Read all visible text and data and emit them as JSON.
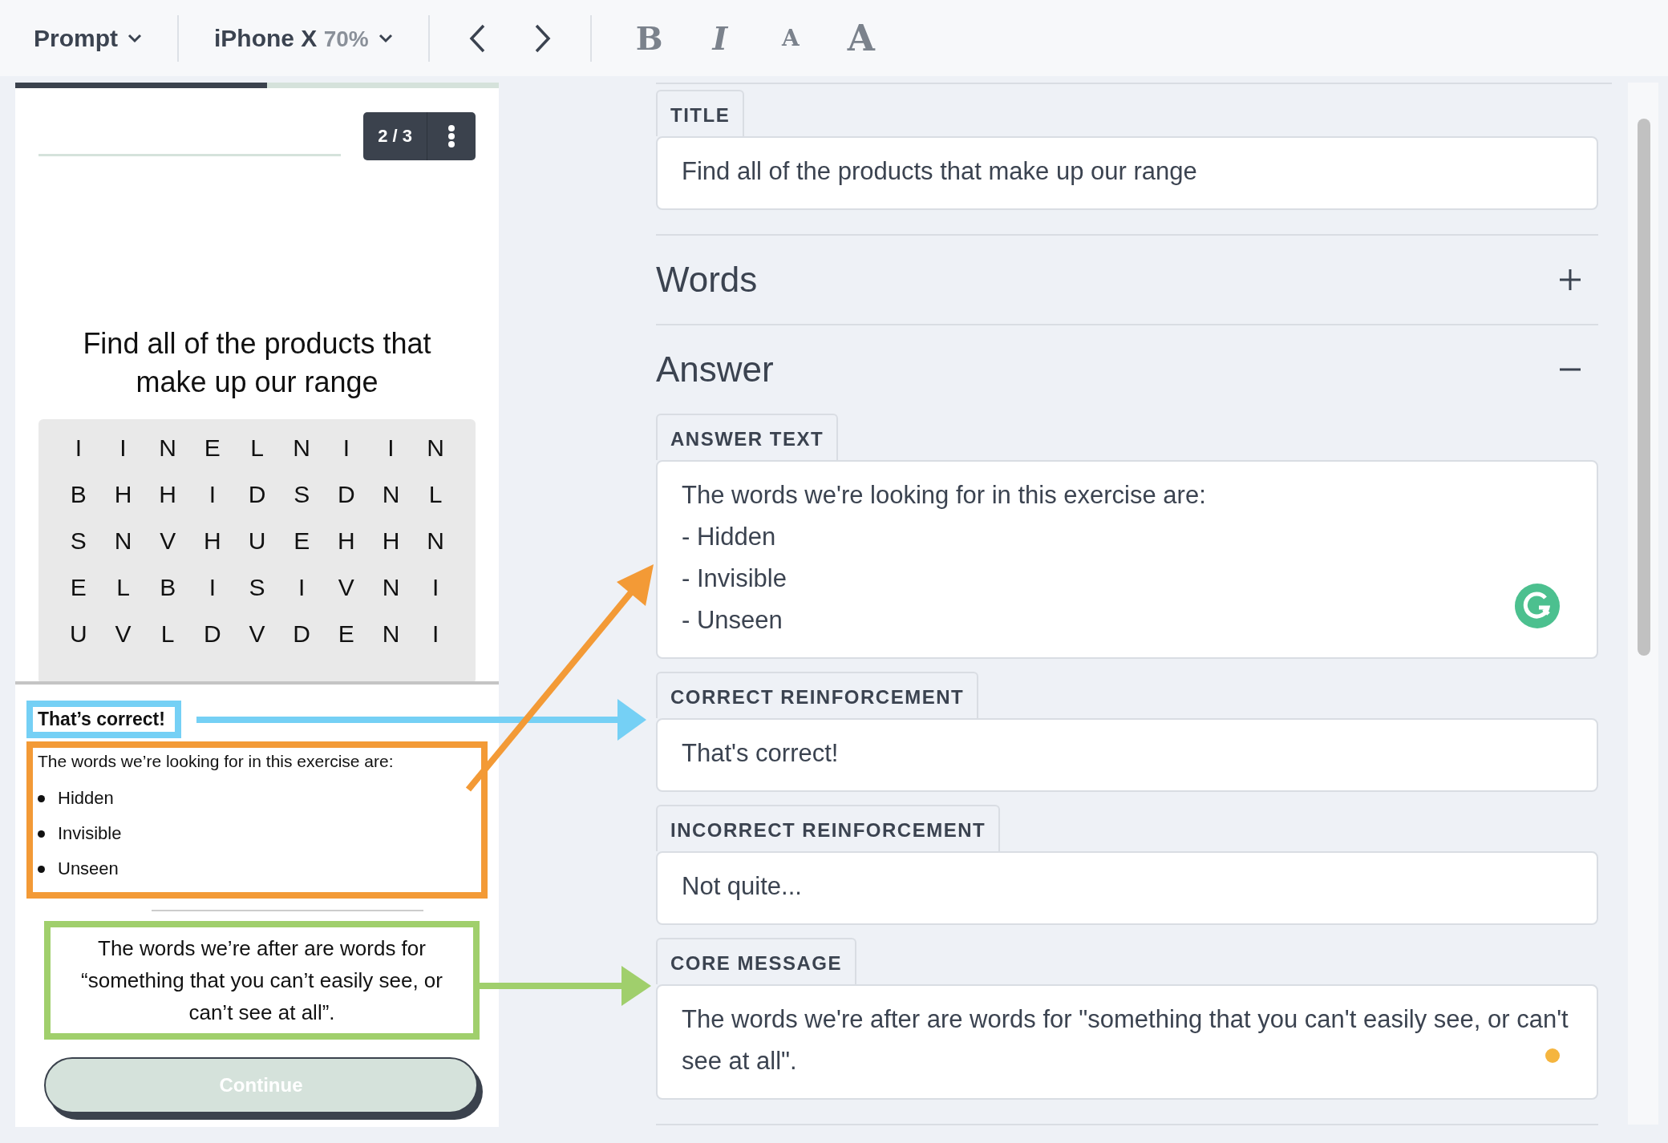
{
  "toolbar": {
    "mode_dropdown": "Prompt",
    "device_dropdown": {
      "device": "iPhone X",
      "zoom": "70%"
    },
    "format_buttons": [
      {
        "label": "B",
        "kind": "bold"
      },
      {
        "label": "I",
        "kind": "italic"
      },
      {
        "label": "A",
        "kind": "small"
      },
      {
        "label": "A",
        "kind": "large"
      }
    ]
  },
  "preview": {
    "progress": {
      "level": 0.52
    },
    "counter": "2 / 3",
    "title": "Find all of the products that make up our range",
    "letter_grid": [
      [
        "I",
        "I",
        "N",
        "E",
        "L",
        "N",
        "I",
        "I",
        "N"
      ],
      [
        "B",
        "H",
        "H",
        "I",
        "D",
        "S",
        "D",
        "N",
        "L"
      ],
      [
        "S",
        "N",
        "V",
        "H",
        "U",
        "E",
        "H",
        "H",
        "N"
      ],
      [
        "E",
        "L",
        "B",
        "I",
        "S",
        "I",
        "V",
        "N",
        "I"
      ],
      [
        "U",
        "V",
        "L",
        "D",
        "V",
        "D",
        "E",
        "N",
        "I"
      ]
    ],
    "feedback": {
      "correct": "That’s correct!",
      "answer_intro": "The words we’re looking for in this exercise are:",
      "answer_items": [
        "Hidden",
        "Invisible",
        "Unseen"
      ],
      "core_message": "The words we’re after are words for “something that you can’t easily see, or can’t see at all”."
    },
    "continue_button": "Continue"
  },
  "editor": {
    "title_field": {
      "label": "TITLE",
      "value": "Find all of the products that make up our range"
    },
    "sections": [
      {
        "title": "Words",
        "expanded": false
      },
      {
        "title": "Answer",
        "expanded": true
      }
    ],
    "answer_fields": [
      {
        "label": "ANSWER TEXT",
        "lines": [
          "The words we're looking for in this exercise are:",
          "- Hidden",
          "- Invisible",
          "- Unseen"
        ],
        "kind": "grammar"
      },
      {
        "label": "CORRECT REINFORCEMENT",
        "lines": [
          "That's correct!"
        ],
        "kind": "plain"
      },
      {
        "label": "INCORRECT REINFORCEMENT",
        "lines": [
          "Not quite..."
        ],
        "kind": "plain"
      },
      {
        "label": "CORE MESSAGE",
        "lines": [
          "The words we're after are words for \"something that you can't easily see, or can't see at all\"."
        ],
        "kind": "pending"
      }
    ]
  },
  "annotations": [
    {
      "color": "#75d0f5"
    },
    {
      "color": "#f39a36"
    },
    {
      "color": "#a0cf6c"
    }
  ]
}
